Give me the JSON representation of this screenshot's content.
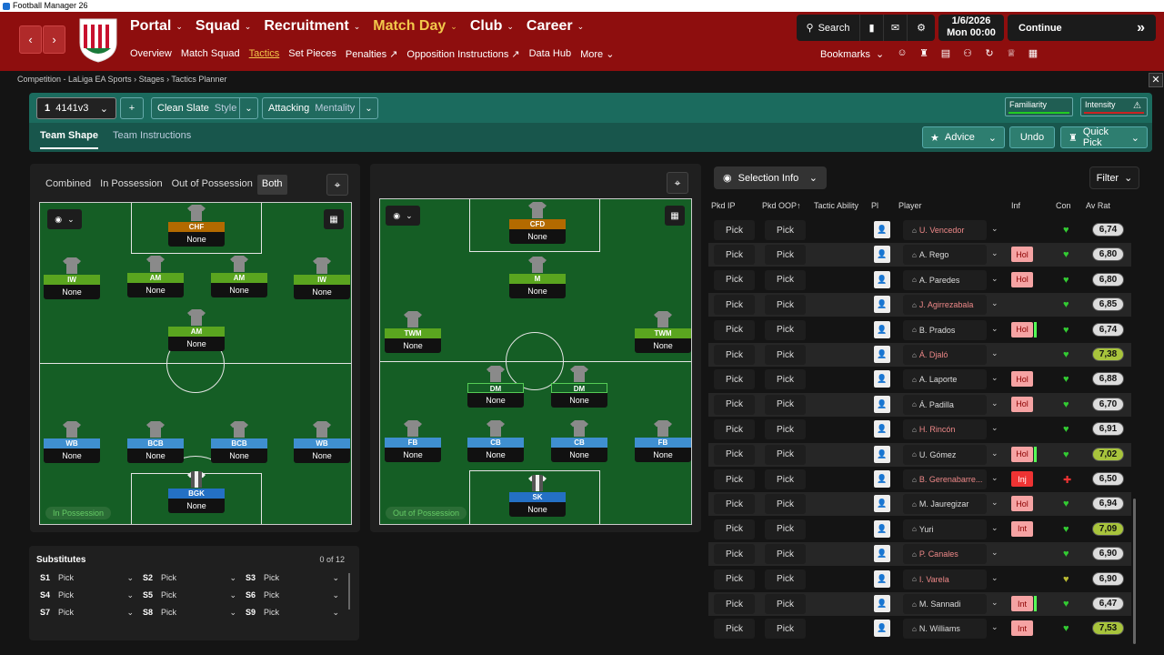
{
  "window": {
    "title": "Football Manager 26"
  },
  "nav": {
    "main": [
      "Portal",
      "Squad",
      "Recruitment",
      "Match Day",
      "Club",
      "Career"
    ],
    "sub": [
      "Overview",
      "Match Squad",
      "Tactics",
      "Set Pieces",
      "Penalties ↗",
      "Opposition Instructions ↗",
      "Data Hub",
      "More ⌄"
    ],
    "search_label": "Search",
    "date_line1": "1/6/2026",
    "date_line2": "Mon  00:00",
    "continue_label": "Continue",
    "bookmarks_label": "Bookmarks"
  },
  "breadcrumb": "Competition - LaLiga EA Sports  ›  Stages  ›  Tactics Planner",
  "toolbar": {
    "formation_num": "1",
    "formation_name": "4141v3",
    "style_value": "Clean Slate",
    "style_label": "Style",
    "mentality_value": "Attacking",
    "mentality_label": "Mentality",
    "familiarity_label": "Familiarity",
    "intensity_label": "Intensity",
    "tab_shape": "Team Shape",
    "tab_instructions": "Team Instructions",
    "advice_label": "Advice",
    "undo_label": "Undo",
    "quickpick_label": "Quick Pick"
  },
  "shape_filter": [
    "Combined",
    "In Possession",
    "Out of Possession",
    "Both"
  ],
  "in_possession": {
    "badge": "In Possession",
    "positions": [
      {
        "role": "CHF",
        "duty": "None"
      },
      {
        "role": "IW",
        "duty": "None"
      },
      {
        "role": "AM",
        "duty": "None"
      },
      {
        "role": "AM",
        "duty": "None"
      },
      {
        "role": "IW",
        "duty": "None"
      },
      {
        "role": "AM",
        "duty": "None"
      },
      {
        "role": "WB",
        "duty": "None"
      },
      {
        "role": "BCB",
        "duty": "None"
      },
      {
        "role": "BCB",
        "duty": "None"
      },
      {
        "role": "WB",
        "duty": "None"
      },
      {
        "role": "BGK",
        "duty": "None"
      }
    ]
  },
  "out_possession": {
    "badge": "Out of Possession",
    "positions": [
      {
        "role": "CFD",
        "duty": "None"
      },
      {
        "role": "M",
        "duty": "None"
      },
      {
        "role": "TWM",
        "duty": "None"
      },
      {
        "role": "TWM",
        "duty": "None"
      },
      {
        "role": "DM",
        "duty": "None"
      },
      {
        "role": "DM",
        "duty": "None"
      },
      {
        "role": "FB",
        "duty": "None"
      },
      {
        "role": "CB",
        "duty": "None"
      },
      {
        "role": "CB",
        "duty": "None"
      },
      {
        "role": "FB",
        "duty": "None"
      },
      {
        "role": "SK",
        "duty": "None"
      }
    ]
  },
  "substitutes": {
    "title": "Substitutes",
    "count": "0 of 12",
    "slots": [
      {
        "id": "S1",
        "value": "Pick"
      },
      {
        "id": "S2",
        "value": "Pick"
      },
      {
        "id": "S3",
        "value": "Pick"
      },
      {
        "id": "S4",
        "value": "Pick"
      },
      {
        "id": "S5",
        "value": "Pick"
      },
      {
        "id": "S6",
        "value": "Pick"
      },
      {
        "id": "S7",
        "value": "Pick"
      },
      {
        "id": "S8",
        "value": "Pick"
      },
      {
        "id": "S9",
        "value": "Pick"
      }
    ]
  },
  "selection": {
    "label": "Selection Info",
    "filter_label": "Filter"
  },
  "table": {
    "headers": [
      "Pkd IP",
      "Pkd OOP",
      "Tactic Ability",
      "Pl",
      "Player",
      "Inf",
      "Con",
      "Av Rat"
    ],
    "rows": [
      {
        "ip": "Pick",
        "oop": "Pick",
        "player": "U. Vencedor",
        "inf": "",
        "bar": false,
        "con": "♥",
        "con_color": "#3c3",
        "rating": "6,74",
        "hi": false,
        "name_color": "#e88"
      },
      {
        "ip": "Pick",
        "oop": "Pick",
        "player": "A. Rego",
        "inf": "Hol",
        "bar": false,
        "con": "♥",
        "con_color": "#3c3",
        "rating": "6,80",
        "hi": false,
        "name_color": "#ddd"
      },
      {
        "ip": "Pick",
        "oop": "Pick",
        "player": "A. Paredes",
        "inf": "Hol",
        "bar": false,
        "con": "♥",
        "con_color": "#3c3",
        "rating": "6,80",
        "hi": false,
        "name_color": "#ddd"
      },
      {
        "ip": "Pick",
        "oop": "Pick",
        "player": "J. Agirrezabala",
        "inf": "",
        "bar": false,
        "con": "♥",
        "con_color": "#3c3",
        "rating": "6,85",
        "hi": false,
        "name_color": "#e88"
      },
      {
        "ip": "Pick",
        "oop": "Pick",
        "player": "B. Prados",
        "inf": "Hol",
        "bar": true,
        "con": "♥",
        "con_color": "#3c3",
        "rating": "6,74",
        "hi": false,
        "name_color": "#ddd"
      },
      {
        "ip": "Pick",
        "oop": "Pick",
        "player": "Á. Djaló",
        "inf": "",
        "bar": false,
        "con": "♥",
        "con_color": "#3c3",
        "rating": "7,38",
        "hi": true,
        "name_color": "#e88"
      },
      {
        "ip": "Pick",
        "oop": "Pick",
        "player": "A. Laporte",
        "inf": "Hol",
        "bar": false,
        "con": "♥",
        "con_color": "#3c3",
        "rating": "6,88",
        "hi": false,
        "name_color": "#ddd"
      },
      {
        "ip": "Pick",
        "oop": "Pick",
        "player": "Á. Padilla",
        "inf": "Hol",
        "bar": false,
        "con": "♥",
        "con_color": "#3c3",
        "rating": "6,70",
        "hi": false,
        "name_color": "#ddd"
      },
      {
        "ip": "Pick",
        "oop": "Pick",
        "player": "H. Rincón",
        "inf": "",
        "bar": false,
        "con": "♥",
        "con_color": "#3c3",
        "rating": "6,91",
        "hi": false,
        "name_color": "#e88"
      },
      {
        "ip": "Pick",
        "oop": "Pick",
        "player": "U. Gómez",
        "inf": "Hol",
        "bar": true,
        "con": "♥",
        "con_color": "#3c3",
        "rating": "7,02",
        "hi": true,
        "name_color": "#ddd"
      },
      {
        "ip": "Pick",
        "oop": "Pick",
        "player": "B. Gerenabarre...",
        "inf": "Inj",
        "bar": false,
        "con": "✚",
        "con_color": "#e33",
        "rating": "6,50",
        "hi": false,
        "name_color": "#e88"
      },
      {
        "ip": "Pick",
        "oop": "Pick",
        "player": "M. Jauregizar",
        "inf": "Hol",
        "bar": false,
        "con": "♥",
        "con_color": "#3c3",
        "rating": "6,94",
        "hi": false,
        "name_color": "#ddd"
      },
      {
        "ip": "Pick",
        "oop": "Pick",
        "player": "Yuri",
        "inf": "Int",
        "bar": false,
        "con": "♥",
        "con_color": "#3c3",
        "rating": "7,09",
        "hi": true,
        "name_color": "#ddd"
      },
      {
        "ip": "Pick",
        "oop": "Pick",
        "player": "P. Canales",
        "inf": "",
        "bar": false,
        "con": "♥",
        "con_color": "#3c3",
        "rating": "6,90",
        "hi": false,
        "name_color": "#e88"
      },
      {
        "ip": "Pick",
        "oop": "Pick",
        "player": "I. Varela",
        "inf": "",
        "bar": false,
        "con": "♥",
        "con_color": "#bb3",
        "rating": "6,90",
        "hi": false,
        "name_color": "#e88"
      },
      {
        "ip": "Pick",
        "oop": "Pick",
        "player": "M. Sannadi",
        "inf": "Int",
        "bar": true,
        "con": "♥",
        "con_color": "#3c3",
        "rating": "6,47",
        "hi": false,
        "name_color": "#ddd"
      },
      {
        "ip": "Pick",
        "oop": "Pick",
        "player": "N. Williams",
        "inf": "Int",
        "bar": false,
        "con": "♥",
        "con_color": "#3c3",
        "rating": "7,53",
        "hi": true,
        "name_color": "#ddd"
      }
    ]
  },
  "colors": {
    "header_red": "#8e0e0e",
    "active_gold": "#f2c84b",
    "teal": "#1b6b5e",
    "pitch": "#155e25"
  }
}
